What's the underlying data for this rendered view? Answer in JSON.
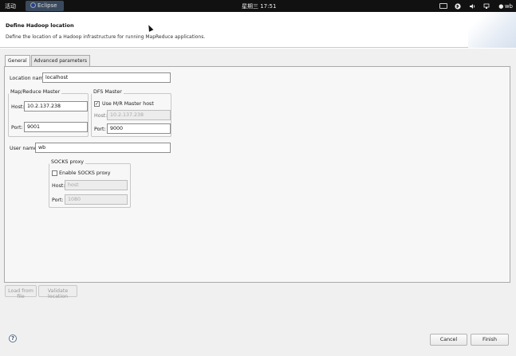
{
  "topbar": {
    "activities": "活动",
    "app_name": "Eclipse",
    "clock": "星期三 17:51",
    "tray": {
      "keyboard_icon": "keyboard-icon",
      "bluetooth_icon": "bluetooth-icon",
      "volume_icon": "volume-icon",
      "network_icon": "network-icon",
      "user_icon": "user-icon",
      "user_name": "wb"
    }
  },
  "header": {
    "title": "Define Hadoop location",
    "description": "Define the location of a Hadoop infrastructure for running MapReduce applications."
  },
  "tabs": [
    {
      "label": "General",
      "active": true
    },
    {
      "label": "Advanced parameters",
      "active": false
    }
  ],
  "general": {
    "location_name_label": "Location name:",
    "location_name_value": "localhost",
    "mr_master": {
      "title": "Map/Reduce Master",
      "host_label": "Host:",
      "host_value": "10.2.137.238",
      "port_label": "Port:",
      "port_value": "9001"
    },
    "dfs_master": {
      "title": "DFS Master",
      "use_mr_host_label": "Use M/R Master host",
      "use_mr_host_checked": true,
      "check_glyph": "✓",
      "host_label": "Host:",
      "host_value": "10.2.137.238",
      "port_label": "Port:",
      "port_value": "9000"
    },
    "user_name_label": "User name:",
    "user_name_value": "wb",
    "socks": {
      "title": "SOCKS proxy",
      "enable_label": "Enable SOCKS proxy",
      "enable_checked": false,
      "host_label": "Host:",
      "host_value": "host",
      "port_label": "Port:",
      "port_value": "1080"
    }
  },
  "buttons": {
    "load_from_file": "Load from file",
    "validate_location": "Validate location",
    "cancel": "Cancel",
    "finish": "Finish"
  },
  "help_glyph": "?"
}
